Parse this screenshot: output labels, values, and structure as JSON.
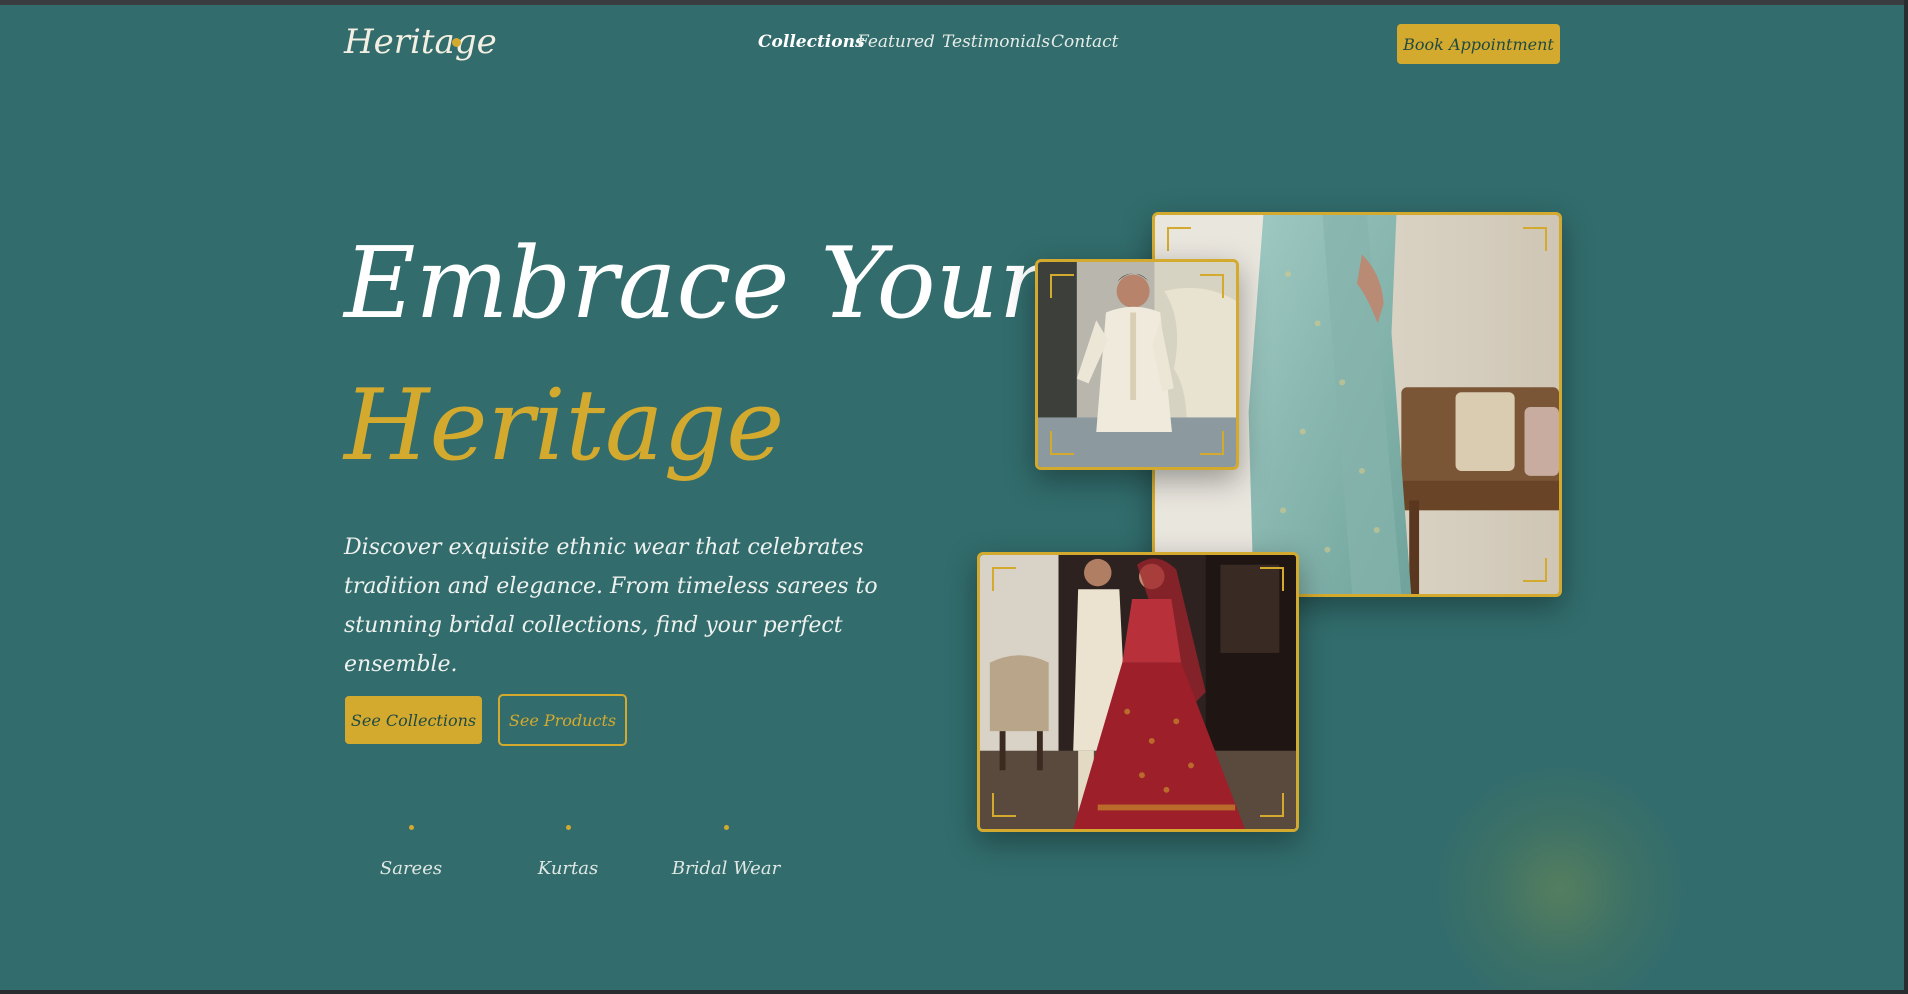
{
  "header": {
    "logo": "Heritage",
    "nav": [
      {
        "label": "Collections",
        "active": true
      },
      {
        "label": "Featured",
        "active": false
      },
      {
        "label": "Testimonials",
        "active": false
      },
      {
        "label": "Contact",
        "active": false
      }
    ],
    "cta_label": "Book Appointment"
  },
  "hero": {
    "title_line1": "Embrace Your",
    "title_line2": "Heritage",
    "description": "Discover exquisite ethnic wear that celebrates tradition and elegance. From timeless sarees to stunning bridal collections, find your perfect ensemble.",
    "primary_button": "See Collections",
    "secondary_button": "See Products",
    "categories": [
      "Sarees",
      "Kurtas",
      "Bridal Wear"
    ]
  },
  "images": [
    {
      "name": "saree-photo-icon"
    },
    {
      "name": "kurta-photo-icon"
    },
    {
      "name": "bridal-photo-icon"
    }
  ],
  "colors": {
    "background": "#1f5e5e",
    "accent": "#d4aa2e",
    "text": "#f4efe3"
  }
}
